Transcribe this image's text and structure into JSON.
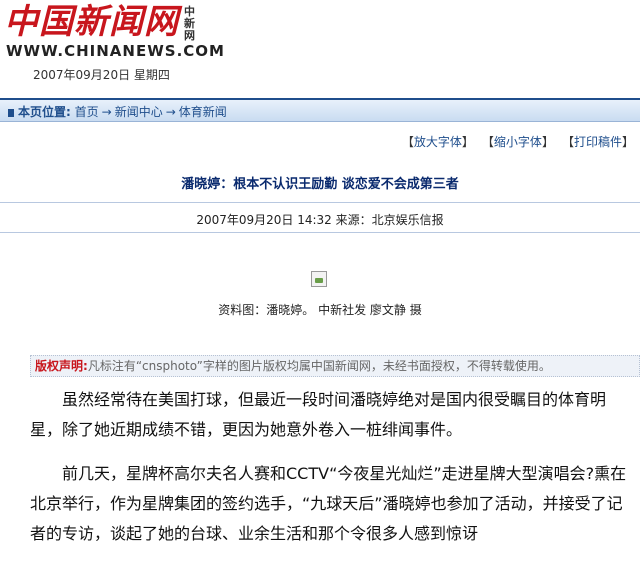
{
  "header": {
    "logo_text": "中国新闻网",
    "logo_small": "中新网",
    "logo_url": "WWW.CHINANEWS.COM",
    "date": "2007年09月20日 星期四"
  },
  "nav": {
    "label": "本页位置:",
    "crumbs": [
      "首页",
      "新闻中心",
      "体育新闻"
    ],
    "separator": "→"
  },
  "toolbar": {
    "zoom_in": "放大字体",
    "zoom_out": "缩小字体",
    "print": "打印稿件"
  },
  "article": {
    "title": "潘晓婷：根本不认识王励勤 谈恋爱不会成第三者",
    "meta": "2007年09月20日 14:32 来源：北京娱乐信报",
    "caption": "资料图：潘晓婷。 中新社发 廖文静 摄",
    "copyright_label": "版权声明:",
    "copyright_text": "凡标注有“cnsphoto”字样的图片版权均属中国新闻网，未经书面授权，不得转载使用。",
    "paragraphs": [
      "虽然经常待在美国打球，但最近一段时间潘晓婷绝对是国内很受瞩目的体育明星，除了她近期成绩不错，更因为她意外卷入一桩绯闻事件。",
      "前几天，星牌杯高尔夫名人赛和CCTV“今夜星光灿烂”走进星牌大型演唱会?熏在北京举行，作为星牌集团的签约选手，“九球天后”潘晓婷也参加了活动，并接受了记者的专访，谈起了她的台球、业余生活和那个令很多人感到惊讶"
    ]
  },
  "colors": {
    "brand_red": "#c8161d",
    "nav_blue": "#1f4e8c",
    "title_blue": "#0a2a6e"
  }
}
